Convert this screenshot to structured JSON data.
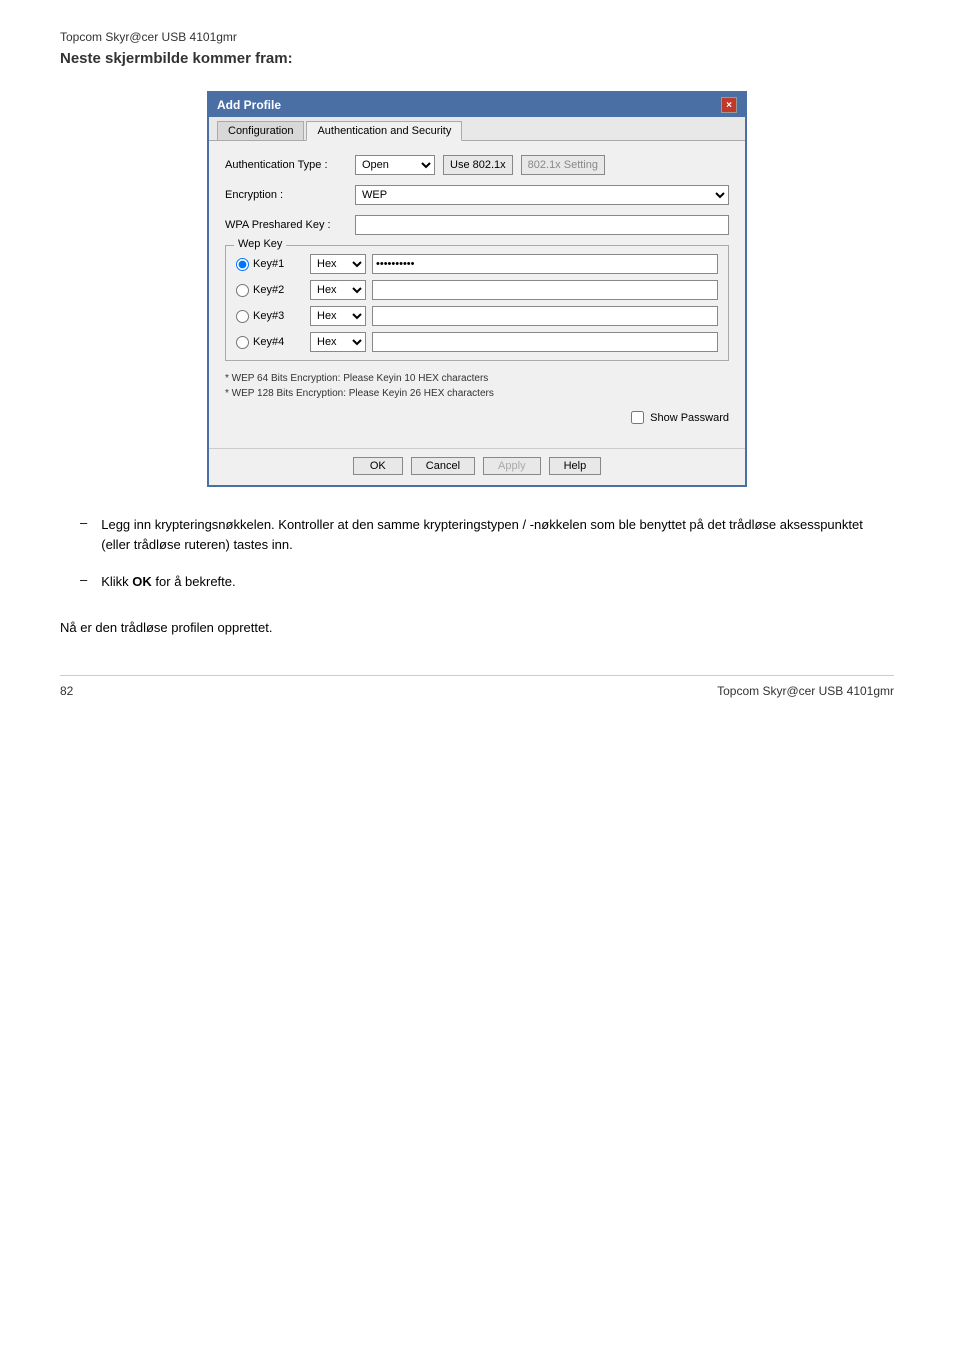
{
  "header": {
    "top_title": "Topcom Skyr@cer USB 4101gmr",
    "sub_title": "Neste skjermbilde kommer fram:"
  },
  "dialog": {
    "title": "Add Profile",
    "close_btn": "×",
    "tabs": [
      {
        "label": "Configuration",
        "active": false
      },
      {
        "label": "Authentication and Security",
        "active": true
      }
    ],
    "auth_type_label": "Authentication Type :",
    "auth_type_value": "Open",
    "use_802_label": "Use 802.1x",
    "setting_802_label": "802.1x Setting",
    "encryption_label": "Encryption :",
    "encryption_value": "WEP",
    "wpa_label": "WPA Preshared Key :",
    "wpa_value": "",
    "wep_group_label": "Wep Key",
    "wep_keys": [
      {
        "id": "Key#1",
        "type": "Hex",
        "value": "xxxxxxxxxx",
        "selected": true
      },
      {
        "id": "Key#2",
        "type": "Hex",
        "value": "",
        "selected": false
      },
      {
        "id": "Key#3",
        "type": "Hex",
        "value": "",
        "selected": false
      },
      {
        "id": "Key#4",
        "type": "Hex",
        "value": "",
        "selected": false
      }
    ],
    "hint_line1": "* WEP 64 Bits Encryption:   Please Keyin 10 HEX characters",
    "hint_line2": "* WEP 128 Bits Encryption:  Please Keyin 26 HEX characters",
    "show_password_label": "Show Passward",
    "buttons": {
      "ok": "OK",
      "cancel": "Cancel",
      "apply": "Apply",
      "help": "Help"
    }
  },
  "bullets": [
    {
      "dash": "–",
      "text": "Legg inn krypteringsnøkkelen. Kontroller at den samme krypteringstypen / -nøkkelen som ble benyttet på det trådløse aksesspunktet (eller trådløse ruteren) tastes inn."
    },
    {
      "dash": "–",
      "text_before": "Klikk ",
      "text_bold": "OK",
      "text_after": " for å bekrefte."
    }
  ],
  "profile_created": "Nå er den trådløse profilen opprettet.",
  "footer": {
    "page_number": "82",
    "brand": "Topcom Skyr@cer USB 4101gmr"
  }
}
